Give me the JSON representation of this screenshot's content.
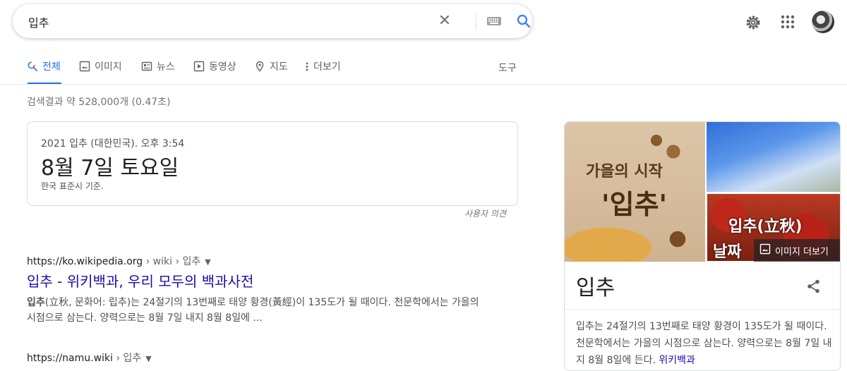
{
  "search": {
    "query": "입추"
  },
  "tabs": [
    {
      "label": "전체",
      "icon": "search-icon",
      "active": true
    },
    {
      "label": "이미지",
      "icon": "image-icon"
    },
    {
      "label": "뉴스",
      "icon": "news-icon"
    },
    {
      "label": "동영상",
      "icon": "video-icon"
    },
    {
      "label": "지도",
      "icon": "map-pin-icon"
    },
    {
      "label": "더보기",
      "icon": "more-vert-icon"
    }
  ],
  "tools_label": "도구",
  "result_stats": "검색결과 약 528,000개 (0.47초)",
  "date_card": {
    "context": "2021 입추 (대한민국). 오후 3:54",
    "date": "8월 7일 토요일",
    "timezone": "한국 표준시 기준."
  },
  "feedback_label": "사용자 의견",
  "results": [
    {
      "cite_host": "https://ko.wikipedia.org",
      "cite_path": " › wiki › 입추",
      "title": "입추 - 위키백과, 우리 모두의 백과사전",
      "snippet_bold": "입추",
      "snippet_rest": "(立秋, 문화어: 립추)는 24절기의 13번째로 태양 황경(黃經)이 135도가 될 때이다. 천문학에서는 가을의 시점으로 삼는다. 양력으로는 8월 7일 내지 8월 8일에 ..."
    },
    {
      "cite_host": "https://namu.wiki",
      "cite_path": " › 입추"
    }
  ],
  "knowledge_panel": {
    "image_text_1": "가을의 시작",
    "image_text_2": "'입추'",
    "image_text_3": "입추(立秋)",
    "image_text_4": "날짜",
    "more_images_label": "이미지 더보기",
    "title": "입추",
    "description": "입추는 24절기의 13번째로 태양 황경이 135도가 될 때이다. 천문학에서는 가을의 시점으로 삼는다. 양력으로는 8월 7일 내지 8월 8일에 든다. ",
    "source_link": "위키백과"
  },
  "colors": {
    "accent": "#1a73e8",
    "link": "#1a0dab"
  }
}
